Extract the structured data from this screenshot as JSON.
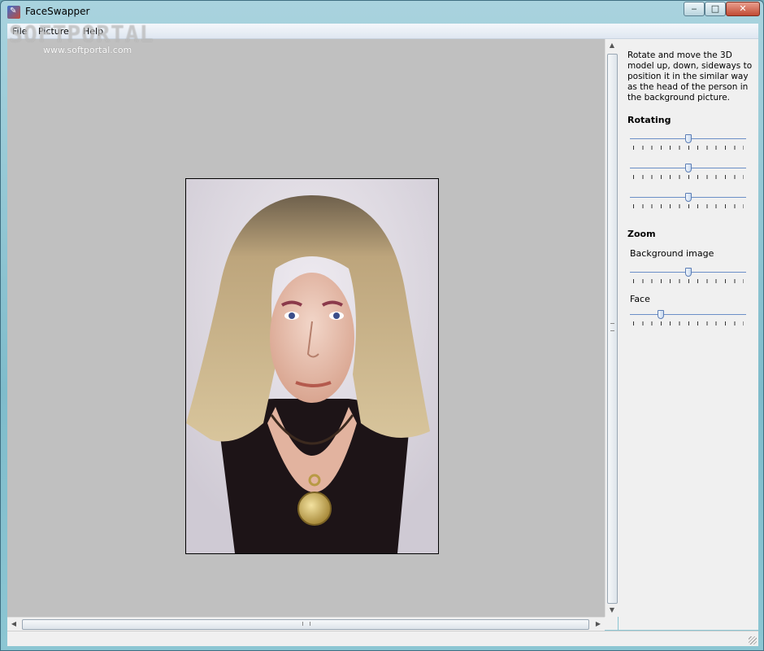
{
  "window": {
    "title": "FaceSwapper"
  },
  "title_buttons": {
    "minimize": "‒",
    "maximize": "□",
    "close": "✕"
  },
  "menu": {
    "items": [
      "File",
      "Picture",
      "Help"
    ]
  },
  "watermark": {
    "logo": "SOFTPORTAL",
    "url": "www.softportal.com"
  },
  "panel": {
    "instructions": "Rotate and move the 3D model up, down, sideways to position it in the similar way as the head of the person in the background picture.",
    "rotating": {
      "title": "Rotating",
      "sliders": [
        {
          "value": 0.5
        },
        {
          "value": 0.5
        },
        {
          "value": 0.5
        }
      ]
    },
    "zoom": {
      "title": "Zoom",
      "background_label": "Background image",
      "background_value": 0.5,
      "face_label": "Face",
      "face_value": 0.25
    }
  },
  "colors": {
    "canvas": "#c0c0c0",
    "panel": "#f0f0f0",
    "slider_accent": "#6b8fc7"
  },
  "icons": {
    "app": "faceswapper-app-icon",
    "scroll_up": "arrow-up-icon",
    "scroll_down": "arrow-down-icon",
    "scroll_left": "arrow-left-icon",
    "scroll_right": "arrow-right-icon"
  }
}
